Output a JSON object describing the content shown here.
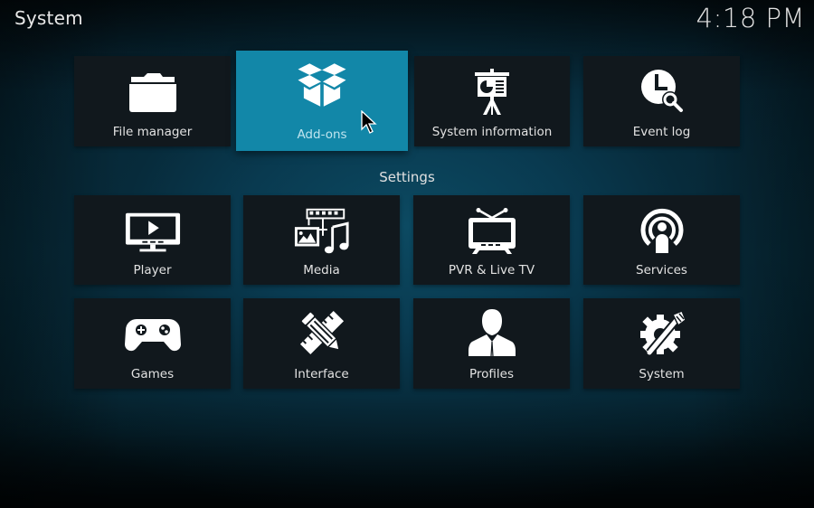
{
  "header": {
    "title": "System",
    "clock": "4:18 PM"
  },
  "top_row": [
    {
      "id": "file-manager",
      "label": "File manager",
      "icon": "folder-icon",
      "focused": false
    },
    {
      "id": "add-ons",
      "label": "Add-ons",
      "icon": "open-box-icon",
      "focused": true
    },
    {
      "id": "system-information",
      "label": "System information",
      "icon": "presentation-board-icon",
      "focused": false
    },
    {
      "id": "event-log",
      "label": "Event log",
      "icon": "clock-search-icon",
      "focused": false
    }
  ],
  "settings": {
    "section_label": "Settings",
    "items": [
      {
        "id": "player",
        "label": "Player",
        "icon": "monitor-play-icon"
      },
      {
        "id": "media",
        "label": "Media",
        "icon": "media-film-image-music-icon"
      },
      {
        "id": "pvr-live-tv",
        "label": "PVR & Live TV",
        "icon": "tv-antenna-icon"
      },
      {
        "id": "services",
        "label": "Services",
        "icon": "broadcast-person-icon"
      },
      {
        "id": "games",
        "label": "Games",
        "icon": "gamepad-icon"
      },
      {
        "id": "interface",
        "label": "Interface",
        "icon": "pencil-ruler-icon"
      },
      {
        "id": "profiles",
        "label": "Profiles",
        "icon": "person-silhouette-icon"
      },
      {
        "id": "system",
        "label": "System",
        "icon": "gear-wrench-icon"
      }
    ]
  },
  "colors": {
    "focus": "#1287a8",
    "tile": "#11181d",
    "background": "#072a38"
  }
}
